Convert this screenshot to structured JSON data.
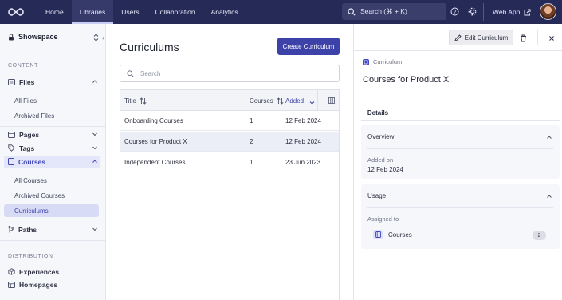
{
  "topnav": {
    "items": [
      {
        "label": "Home",
        "active": false
      },
      {
        "label": "Libraries",
        "active": true
      },
      {
        "label": "Users",
        "active": false
      },
      {
        "label": "Collaboration",
        "active": false
      },
      {
        "label": "Analytics",
        "active": false
      }
    ],
    "search_label": "Search (⌘ + K)",
    "webapp_label": "Web App"
  },
  "sidebar": {
    "workspace": "Showspace",
    "content_title": "CONTENT",
    "files": "Files",
    "all_files": "All Files",
    "archived_files": "Archived Files",
    "pages": "Pages",
    "tags": "Tags",
    "courses": "Courses",
    "all_courses": "All Courses",
    "archived_courses": "Archived Courses",
    "curriculums": "Curriculums",
    "paths": "Paths",
    "distribution_title": "DISTRIBUTION",
    "experiences": "Experiences",
    "homepages": "Homepages"
  },
  "main": {
    "title": "Curriculums",
    "create_button": "Create Curriculum",
    "search_placeholder": "Search",
    "columns": {
      "title": "Title",
      "courses": "Courses",
      "added": "Added"
    },
    "rows": [
      {
        "title": "Onboarding Courses",
        "courses": "1",
        "added": "12 Feb 2024"
      },
      {
        "title": "Courses for Product X",
        "courses": "2",
        "added": "12 Feb 2024"
      },
      {
        "title": "Independent Courses",
        "courses": "1",
        "added": "23 Jun 2023"
      }
    ]
  },
  "panel": {
    "edit_button": "Edit Curriculum",
    "type_label": "Curriculum",
    "title": "Courses for Product X",
    "tab_details": "Details",
    "overview_title": "Overview",
    "added_on_label": "Added on",
    "added_on_value": "12 Feb 2024",
    "usage_title": "Usage",
    "assigned_to_label": "Assigned to",
    "assigned_item": "Courses",
    "assigned_count": "2"
  },
  "colors": {
    "topbar": "#262a57",
    "accent": "#3d42a8",
    "selected_sidebar": "#d8dbf6"
  }
}
